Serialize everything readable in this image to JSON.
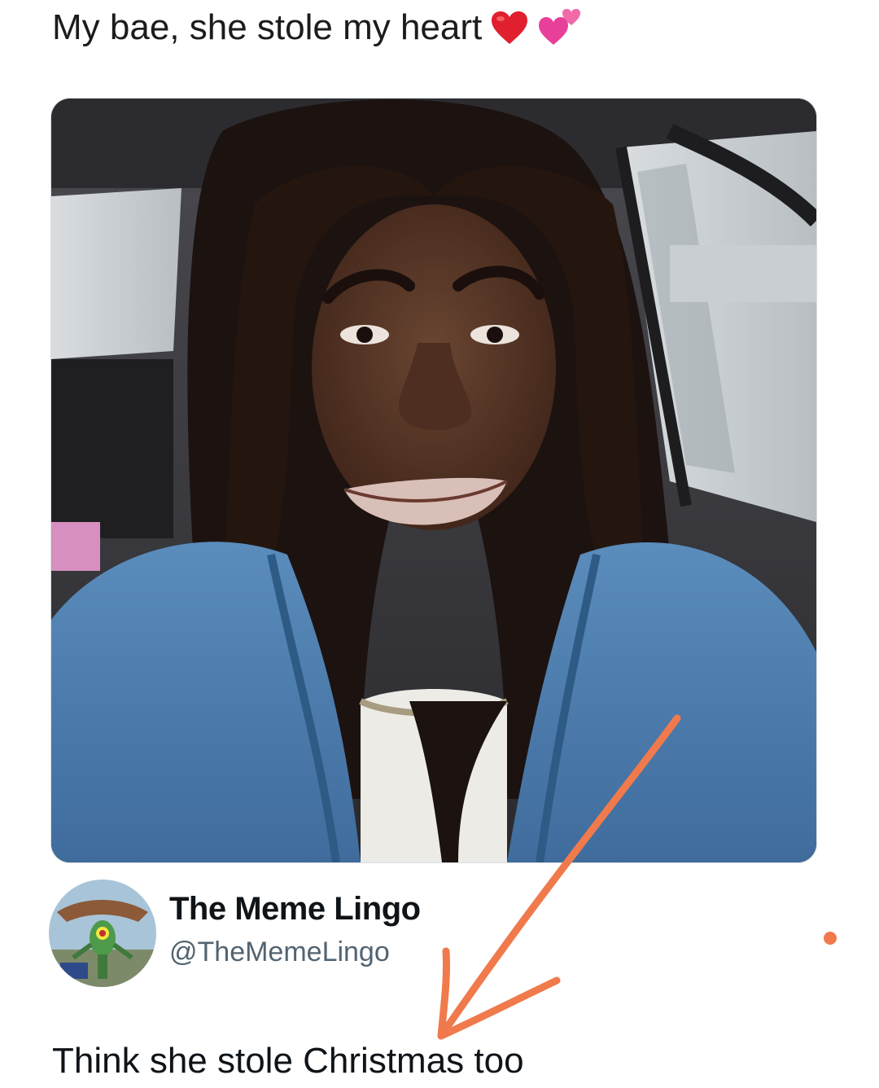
{
  "post": {
    "caption": "My bae, she stole my heart",
    "caption_emoji": [
      "red-heart-icon",
      "two-hearts-icon"
    ]
  },
  "reply": {
    "display_name": "The Meme Lingo",
    "handle": "@TheMemeLingo",
    "text": "Think she stole Christmas too"
  },
  "colors": {
    "annotation_arrow": "#f07a4c",
    "heart_red": "#e0202e",
    "heart_pink": "#e8409a",
    "jacket_blue": "#4d7fb0",
    "text_primary": "#0f1419",
    "text_secondary": "#536471"
  }
}
